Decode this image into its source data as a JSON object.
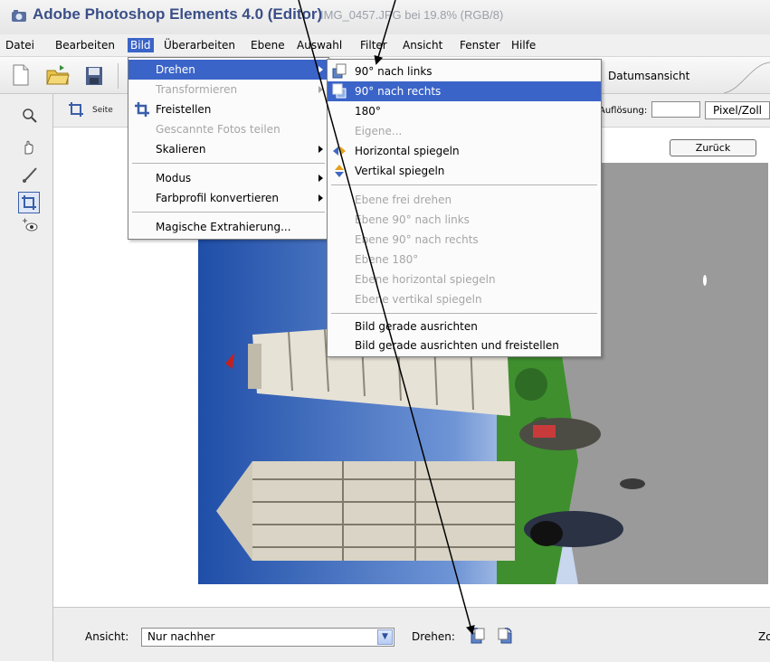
{
  "window": {
    "app_title": "Adobe Photoshop Elements 4.0 (Editor)",
    "doc_title": "IMG_0457.JPG bei 19.8% (RGB/8)"
  },
  "menubar": [
    "Datei",
    "Bearbeiten",
    "Bild",
    "Überarbeiten",
    "Ebene",
    "Auswahl",
    "Filter",
    "Ansicht",
    "Fenster",
    "Hilfe"
  ],
  "menubar_active": "Bild",
  "toolbar": {
    "datumsansicht": "Datumsansicht"
  },
  "options": {
    "seite": "Seite",
    "aufloesung": "Auflösung:",
    "unit": "Pixel/Zoll"
  },
  "canvas": {
    "zurueck": "Zurück"
  },
  "bild_menu": {
    "drehen": "Drehen",
    "transformieren": "Transformieren",
    "freistellen": "Freistellen",
    "gescannte": "Gescannte Fotos teilen",
    "skalieren": "Skalieren",
    "modus": "Modus",
    "farbprofil": "Farbprofil konvertieren",
    "magische": "Magische Extrahierung..."
  },
  "drehen_menu": {
    "links": "90° nach links",
    "rechts": "90° nach rechts",
    "r180": "180°",
    "eigene": "Eigene...",
    "horiz": "Horizontal spiegeln",
    "vert": "Vertikal spiegeln",
    "ebene_frei": "Ebene frei drehen",
    "ebene_links": "Ebene 90° nach links",
    "ebene_rechts": "Ebene 90° nach rechts",
    "ebene_180": "Ebene 180°",
    "ebene_horiz": "Ebene horizontal spiegeln",
    "ebene_vert": "Ebene vertikal spiegeln",
    "gerade": "Bild gerade ausrichten",
    "gerade_frei": "Bild gerade ausrichten und freistellen"
  },
  "bottom": {
    "ansicht_label": "Ansicht:",
    "ansicht_value": "Nur nachher",
    "drehen_label": "Drehen:",
    "zoom_label": "Zo"
  },
  "colors": {
    "highlight": "#3b64c8",
    "title": "#3b4f88",
    "disabled": "#a6a6a6"
  }
}
